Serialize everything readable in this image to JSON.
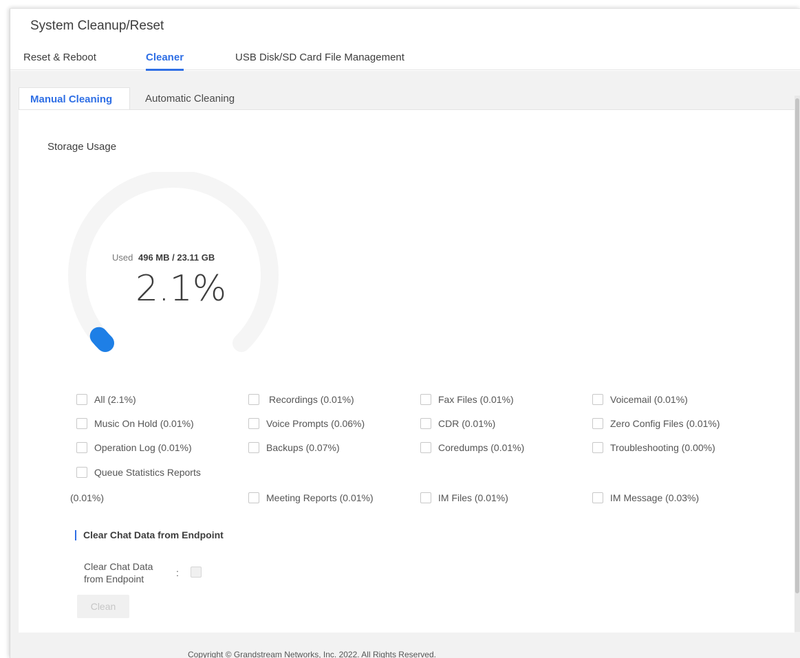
{
  "page_title": "System Cleanup/Reset",
  "top_tabs": [
    {
      "label": "Reset & Reboot"
    },
    {
      "label": "Cleaner"
    },
    {
      "label": "USB Disk/SD Card File Management"
    }
  ],
  "sub_tabs": [
    {
      "label": "Manual Cleaning"
    },
    {
      "label": "Automatic Cleaning"
    }
  ],
  "storage": {
    "label": "Storage Usage",
    "used_prefix": "Used",
    "used_value": "496 MB / 23.11 GB",
    "percent_text": "2.1%",
    "percent": 0.021
  },
  "checkboxes": {
    "all": "All (2.1%)",
    "recordings": "Recordings (0.01%)",
    "fax_files": "Fax Files (0.01%)",
    "voicemail": "Voicemail (0.01%)",
    "music_on_hold": "Music On Hold (0.01%)",
    "voice_prompts": "Voice Prompts (0.06%)",
    "cdr": "CDR (0.01%)",
    "zero_config": "Zero Config Files (0.01%)",
    "operation_log": "Operation Log (0.01%)",
    "backups": "Backups (0.07%)",
    "coredumps": "Coredumps (0.01%)",
    "troubleshooting": "Troubleshooting (0.00%)",
    "queue_stats": "Queue Statistics Reports",
    "queue_stats_pct": "(0.01%)",
    "meeting_reports": "Meeting Reports (0.01%)",
    "im_files": "IM Files (0.01%)",
    "im_message": "IM Message (0.03%)"
  },
  "clear_chat": {
    "section_title": "Clear Chat Data from Endpoint",
    "field_label_line1": "Clear Chat Data",
    "field_label_line2": "from Endpoint",
    "colon": ":"
  },
  "clean_button": "Clean",
  "footer": "Copyright © Grandstream Networks, Inc. 2022. All Rights Reserved.",
  "colors": {
    "accent": "#2f6fe5",
    "gauge_track": "#f5f5f5",
    "gauge_fill": "#1e7fe6"
  }
}
